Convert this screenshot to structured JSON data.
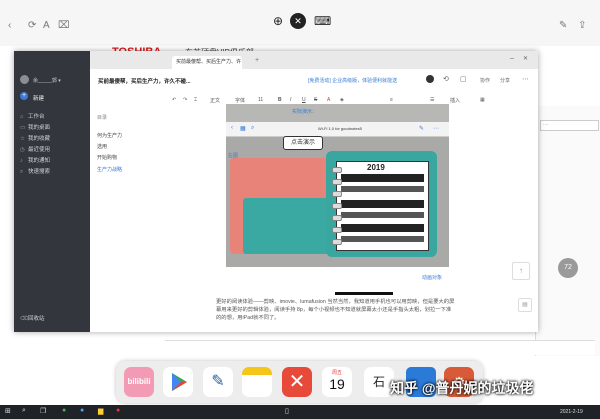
{
  "system": {
    "zoom_icon": "zoom-in-icon",
    "mute_icon": "mute-icon",
    "keyboard_icon": "keyboard-icon"
  },
  "background": {
    "brand": "TOSHIBA",
    "brand_suffix": "东芝硬盘VIP俱乐部",
    "right_label": "...."
  },
  "app": {
    "username": "余_____郭 ▾",
    "new_label": "新建",
    "sidebar": [
      "工作台",
      "我的桌面",
      "我的收藏",
      "最近使用",
      "我的通知",
      "快速搜索"
    ],
    "recycle": "回收站",
    "tab_title": "买前最傻帮、买后生产力、许久...",
    "tab_add": "+",
    "doc_title": "买前最傻帮，买后生产力，许久不碰...",
    "header_notice": "[免费活动] 企业高级版，体验便利就能送",
    "collab": "协作",
    "share": "分享",
    "toolbar": {
      "body": "正文",
      "font": "字体",
      "size": "11",
      "insert": "插入"
    },
    "outline_title": "目录",
    "outline": [
      "何为生产力",
      "选用",
      "开始购物",
      "生产力战略"
    ],
    "caption_top": "实际演示：",
    "caption_left": "左图",
    "bubble": "点击演示",
    "year": "2019",
    "caption_right": "动画对象",
    "browser_bar": "Wi-Fi 1.0 for goodnotes5",
    "paragraph": "更好的阅读体验——剪映、imovie、lumafusion 当然当然，我知道用手机也可以用剪映，但是要大的屏幕用来更好的剪辑体验，阅读手持 8p，每个小视频也不知道就屏幕太小还是手指头太粗，划拉一下准的的想，用iPad就不同了。"
  },
  "dock": {
    "bilibili": "bilibili",
    "calendar_day": "周五",
    "calendar_date": "19",
    "ime": "石"
  },
  "watermark": "知乎 @普丹妮的垃圾佬",
  "taskbar": {
    "time": "2021-2-19"
  },
  "colors": {
    "sidebar": "#33373d",
    "accent_red": "#d71a1a",
    "teal": "#39a7a0",
    "pink": "#e8837a"
  }
}
